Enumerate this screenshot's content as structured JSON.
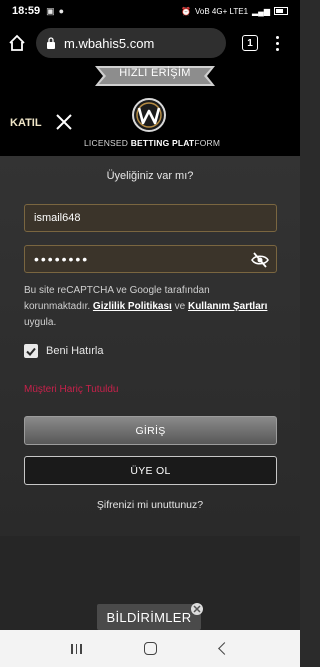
{
  "status_bar": {
    "time": "18:59",
    "network": "VoB 4G+ LTE1"
  },
  "browser": {
    "url": "m.wbahis5.com",
    "tab_count": "1"
  },
  "header": {
    "ribbon_label": "HIZLI ERİŞİM",
    "join_label": "KATIL",
    "tagline_pre": "LICENSED ",
    "tagline_bold": "BETTING PLAT",
    "tagline_post": "FORM"
  },
  "login": {
    "question": "Üyeliğiniz var mı?",
    "username_value": "ismail648",
    "password_mask": "••••••••",
    "captcha_text_1": "Bu site reCAPTCHA ve Google tarafından korunmaktadır. ",
    "privacy_link": "Gizlilik Politikası",
    "captcha_and": " ve ",
    "terms_link": "Kullanım Şartları",
    "captcha_text_2": " uygula.",
    "remember_label": "Beni Hatırla",
    "remember_checked": true,
    "excluded_label": "Müşteri Hariç Tutuldu",
    "login_button": "GİRİŞ",
    "register_button": "ÜYE OL",
    "forgot_label": "Şifrenizi mi unuttunuz?"
  },
  "notifications": {
    "label": "BİLDİRİMLER"
  },
  "colors": {
    "accent_gold": "#7a6640",
    "excluded_red": "#c8214b",
    "background": "#2b2b2b"
  }
}
